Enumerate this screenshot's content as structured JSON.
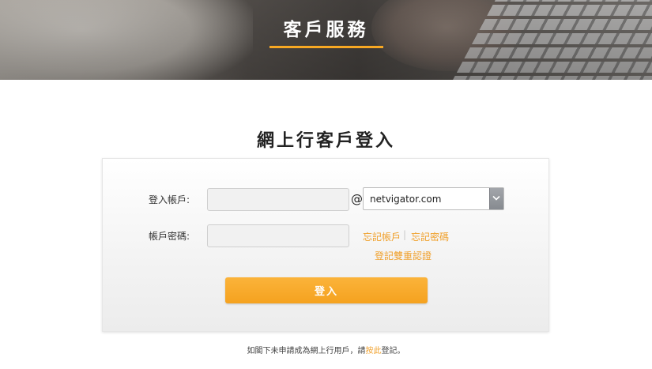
{
  "banner": {
    "title": "客戶服務"
  },
  "page": {
    "heading": "網上行客戶登入"
  },
  "login": {
    "account_label": "登入帳戶:",
    "account_value": "",
    "account_placeholder": "",
    "at_symbol": "@",
    "domain_selected": "netvigator.com",
    "password_label": "帳戶密碼:",
    "password_value": "",
    "password_placeholder": "",
    "forgot_account": "忘記帳戶",
    "separator": "|",
    "forgot_password": "忘記密碼",
    "register_2fa": "登記雙重認證",
    "submit_label": "登入"
  },
  "footer": {
    "note_prefix": "如閣下未申請成為網上行用戶，請",
    "note_link": "按此",
    "note_suffix": "登記。"
  },
  "colors": {
    "accent": "#f7a823",
    "link": "#f0a02b",
    "button": "#f5a21f"
  },
  "icons": {
    "dropdown_arrow": "chevron-down-icon"
  }
}
